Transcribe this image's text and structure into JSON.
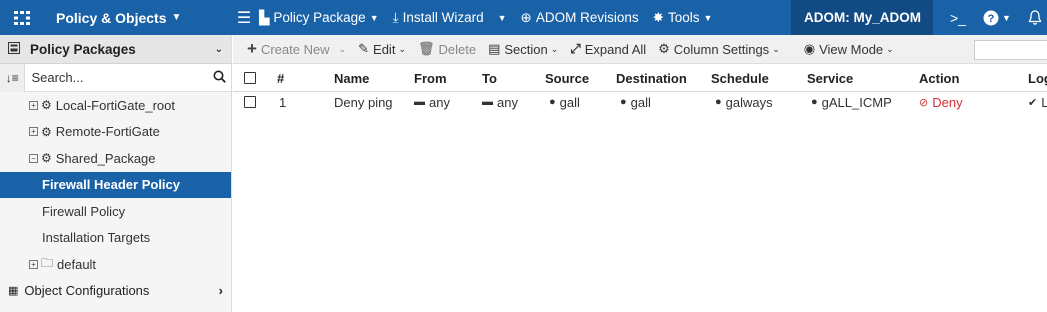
{
  "topbar": {
    "app_title": "Policy & Objects",
    "nav": [
      {
        "label": "Policy Package",
        "icon": "package-icon",
        "dropdown": true
      },
      {
        "label": "Install Wizard",
        "icon": "install-icon",
        "dropdown": true
      },
      {
        "label": "ADOM Revisions",
        "icon": "revisions-icon",
        "dropdown": false
      },
      {
        "label": "Tools",
        "icon": "tools-icon",
        "dropdown": true
      }
    ],
    "adom_label": "ADOM: My_ADOM"
  },
  "sidebar": {
    "header": "Policy Packages",
    "search_placeholder": "Search...",
    "tree": [
      {
        "label": "Local-FortiGate_root",
        "expander": "+"
      },
      {
        "label": "Remote-FortiGate",
        "expander": "+"
      },
      {
        "label": "Shared_Package",
        "expander": "−"
      },
      {
        "label": "Firewall Header Policy",
        "selected": true
      },
      {
        "label": "Firewall Policy"
      },
      {
        "label": "Installation Targets"
      },
      {
        "label": "default",
        "expander": "+"
      }
    ],
    "object_configurations": "Object Configurations"
  },
  "toolbar": {
    "create_new": "Create New",
    "edit": "Edit",
    "delete": "Delete",
    "section": "Section",
    "expand_all": "Expand All",
    "column_settings": "Column Settings",
    "view_mode": "View Mode"
  },
  "table": {
    "columns": [
      "#",
      "Name",
      "From",
      "To",
      "Source",
      "Destination",
      "Schedule",
      "Service",
      "Action",
      "Log"
    ],
    "rows": [
      {
        "num": "1",
        "name": "Deny ping",
        "from": "any",
        "to": "any",
        "source": "gall",
        "destination": "gall",
        "schedule": "galways",
        "service": "gALL_ICMP",
        "action": "Deny",
        "log": "L"
      }
    ]
  },
  "colors": {
    "topbar": "#1a62a8",
    "adom": "#124a83",
    "selected": "#1a62a8",
    "deny": "#d32f2f"
  }
}
